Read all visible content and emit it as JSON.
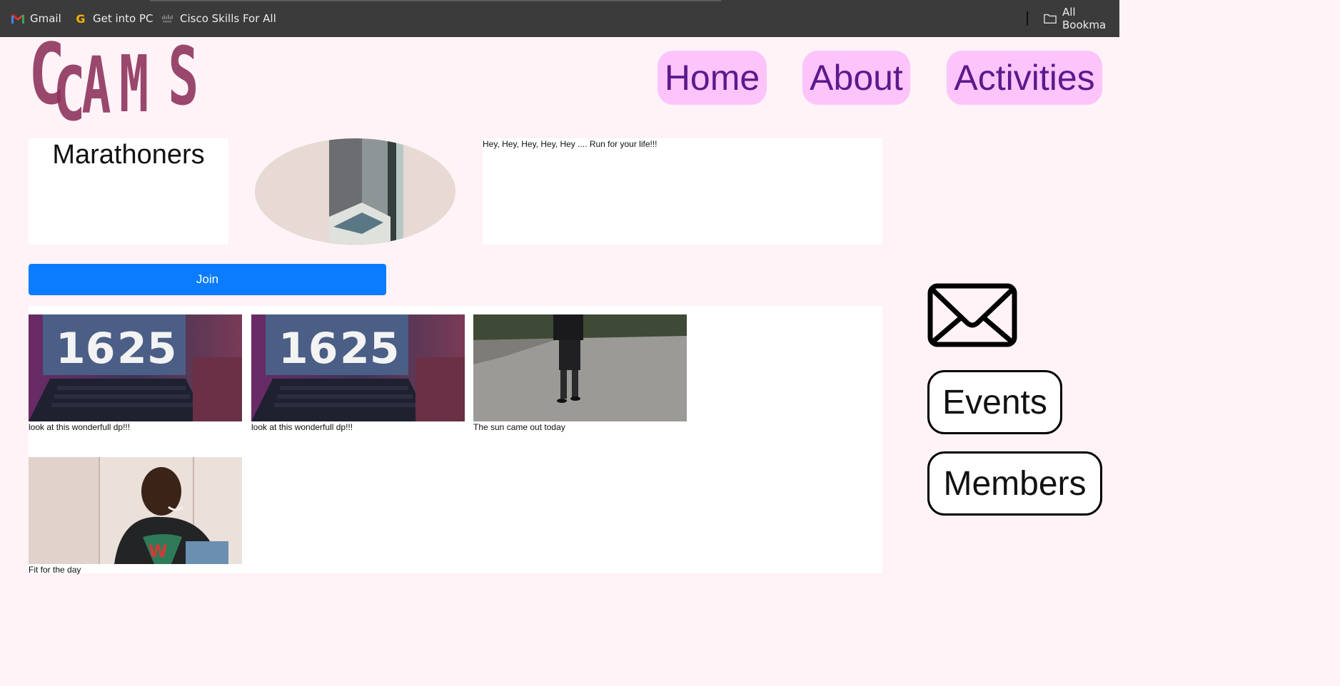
{
  "bookmarks": {
    "items": [
      {
        "label": "Gmail",
        "icon": "gmail-icon"
      },
      {
        "label": "Get into PC",
        "icon": "g-icon"
      },
      {
        "label": "Cisco Skills For All",
        "icon": "cisco-icon"
      }
    ],
    "all_label": "All Bookma"
  },
  "site": {
    "logo_text": "CCAMS",
    "nav": [
      "Home",
      "About",
      "Activities"
    ]
  },
  "group": {
    "name": "Marathoners",
    "description": "Hey, Hey, Hey, Hey, Hey .... Run for your life!!!",
    "join_label": "Join"
  },
  "posts": [
    {
      "caption": "look at this wonderfull dp!!!",
      "clock": [
        "16",
        "25"
      ]
    },
    {
      "caption": "look at this wonderfull dp!!!",
      "clock": [
        "16",
        "25"
      ]
    },
    {
      "caption": "The sun came out today"
    },
    {
      "caption": "Fit for the day"
    }
  ],
  "sidebar": {
    "events_label": "Events",
    "members_label": "Members"
  },
  "colors": {
    "page_bg": "#fff3f7",
    "nav_pill": "#fcc4fb",
    "nav_text": "#5b1a8c",
    "logo": "#8c2f5a",
    "join": "#0b7cff"
  }
}
